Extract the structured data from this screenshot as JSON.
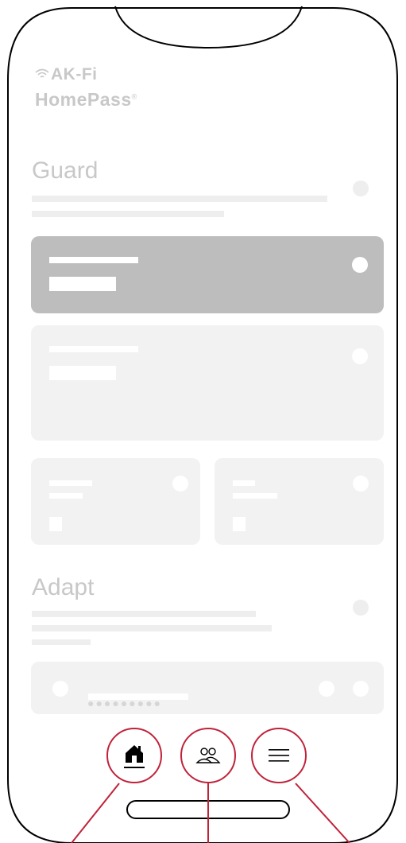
{
  "brand": {
    "line1": "AK-Fi",
    "line2": "HomePass",
    "mark": "®",
    "wifi_icon": "wifi-icon"
  },
  "sections": {
    "guard": "Guard",
    "adapt": "Adapt"
  },
  "network": {
    "password_mask": "●●●●●●●●●"
  },
  "nav": {
    "items": [
      {
        "name": "home",
        "icon": "home-icon",
        "active": true
      },
      {
        "name": "people",
        "icon": "people-icon",
        "active": false
      },
      {
        "name": "menu",
        "icon": "menu-icon",
        "active": false
      }
    ]
  },
  "colors": {
    "accent": "#c0223a",
    "placeholder": "#eeeeee",
    "card": "#f2f2f2",
    "card_selected": "#bdbdbd",
    "outline": "#000000"
  }
}
